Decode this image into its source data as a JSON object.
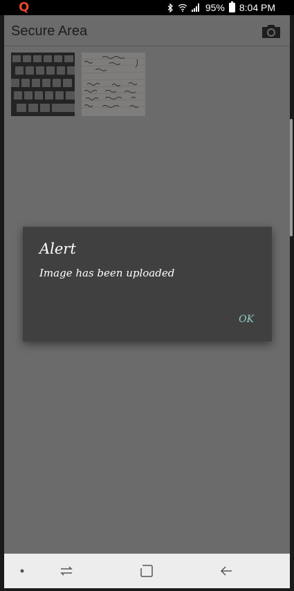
{
  "status_bar": {
    "app_logo": "Q",
    "battery": "95%",
    "time": "8:04 PM",
    "icons": [
      "bluetooth-icon",
      "wifi-icon",
      "signal-icon",
      "battery-icon"
    ]
  },
  "header": {
    "title": "Secure Area",
    "camera_icon": "camera-icon"
  },
  "gallery": {
    "items": [
      {
        "name": "keyboard-photo"
      },
      {
        "name": "notebook-photo"
      }
    ]
  },
  "dialog": {
    "title": "Alert",
    "message": "Image has been uploaded",
    "ok_label": "OK",
    "ok_color": "#8ecfc7"
  },
  "nav_bar": {
    "icons": [
      "dot-icon",
      "recent-apps-icon",
      "home-icon",
      "back-icon"
    ]
  }
}
